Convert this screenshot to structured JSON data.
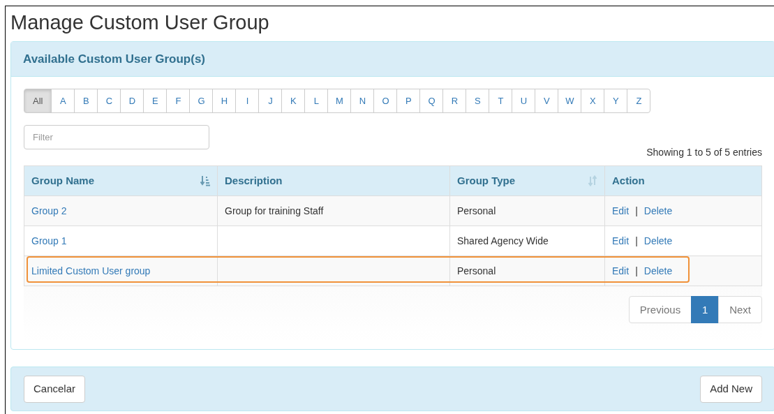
{
  "page_title": "Manage Custom User Group",
  "panel": {
    "title": "Available Custom User Group(s)",
    "letters": [
      {
        "label": "All",
        "selected": true
      },
      {
        "label": "A",
        "selected": false
      },
      {
        "label": "B",
        "selected": false
      },
      {
        "label": "C",
        "selected": false
      },
      {
        "label": "D",
        "selected": false
      },
      {
        "label": "E",
        "selected": false
      },
      {
        "label": "F",
        "selected": false
      },
      {
        "label": "G",
        "selected": false
      },
      {
        "label": "H",
        "selected": false
      },
      {
        "label": "I",
        "selected": false
      },
      {
        "label": "J",
        "selected": false
      },
      {
        "label": "K",
        "selected": false
      },
      {
        "label": "L",
        "selected": false
      },
      {
        "label": "M",
        "selected": false
      },
      {
        "label": "N",
        "selected": false
      },
      {
        "label": "O",
        "selected": false
      },
      {
        "label": "P",
        "selected": false
      },
      {
        "label": "Q",
        "selected": false
      },
      {
        "label": "R",
        "selected": false
      },
      {
        "label": "S",
        "selected": false
      },
      {
        "label": "T",
        "selected": false
      },
      {
        "label": "U",
        "selected": false
      },
      {
        "label": "V",
        "selected": false
      },
      {
        "label": "W",
        "selected": false
      },
      {
        "label": "X",
        "selected": false
      },
      {
        "label": "Y",
        "selected": false
      },
      {
        "label": "Z",
        "selected": false
      }
    ],
    "filter": {
      "placeholder": "Filter"
    },
    "entries_info": "Showing 1 to 5 of 5 entries",
    "table": {
      "columns": [
        {
          "label": "Group Name",
          "kind": "sorted"
        },
        {
          "label": "Description",
          "kind": "plain"
        },
        {
          "label": "Group Type",
          "kind": "sortable"
        },
        {
          "label": "Action",
          "kind": "plain"
        }
      ],
      "rows": [
        {
          "name": "Group 2",
          "description": "Group for training Staff",
          "type": "Personal",
          "edit": "Edit",
          "separator": "|",
          "delete": "Delete",
          "highlighted": false
        },
        {
          "name": "Group 1",
          "type": "Shared Agency Wide",
          "edit": "Edit",
          "separator": "|",
          "delete": "Delete",
          "highlighted": false
        },
        {
          "name": "Limited Custom User group",
          "type": "Personal",
          "edit": "Edit",
          "separator": "|",
          "delete": "Delete",
          "highlighted": true
        }
      ]
    },
    "pagination": {
      "previous": "Previous",
      "pages": [
        {
          "label": "1",
          "selected": true
        }
      ],
      "next": "Next"
    }
  },
  "footer": {
    "cancel": "Cancelar",
    "add": "Add New"
  }
}
